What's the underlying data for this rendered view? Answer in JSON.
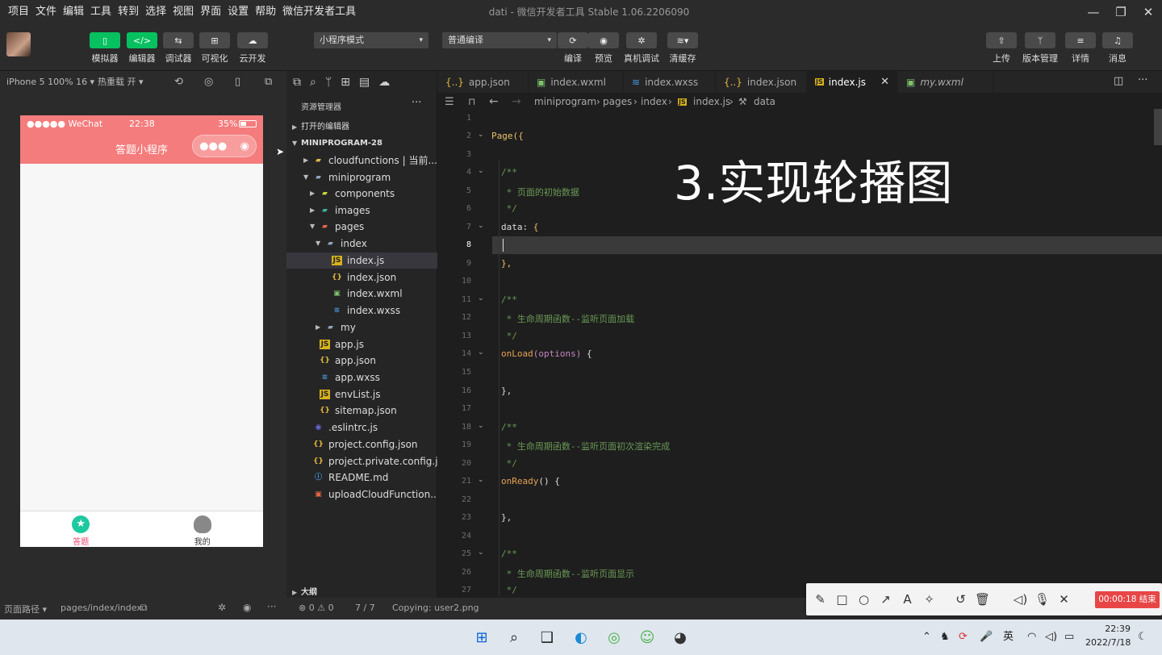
{
  "menu": [
    "项目",
    "文件",
    "编辑",
    "工具",
    "转到",
    "选择",
    "视图",
    "界面",
    "设置",
    "帮助",
    "微信开发者工具"
  ],
  "window_title": "dati - 微信开发者工具 Stable 1.06.2206090",
  "toolbar": {
    "simulator": "模拟器",
    "editor": "编辑器",
    "debugger": "调试器",
    "visual": "可视化",
    "cloud": "云开发",
    "mode_select": "小程序模式",
    "compile_select": "普通编译",
    "compile": "编译",
    "preview": "预览",
    "remote_debug": "真机调试",
    "clear_cache": "清缓存",
    "upload": "上传",
    "version": "版本管理",
    "details": "详情",
    "messages": "消息"
  },
  "devbar": {
    "device": "iPhone 5 100% 16 ▾",
    "hotreload": "热重载 开 ▾"
  },
  "phone": {
    "carrier": "●●●●● WeChat",
    "time": "22:38",
    "battery": "35%",
    "title": "答题小程序",
    "tab1": "答题",
    "tab2": "我的"
  },
  "explorer": {
    "title": "资源管理器",
    "open_editors": "打开的编辑器",
    "project": "MINIPROGRAM-28",
    "outline": "大纲",
    "items": [
      "cloudfunctions | 当前...",
      "miniprogram",
      "components",
      "images",
      "pages",
      "index",
      "index.js",
      "index.json",
      "index.wxml",
      "index.wxss",
      "my",
      "app.js",
      "app.json",
      "app.wxss",
      "envList.js",
      "sitemap.json",
      ".eslintrc.js",
      "project.config.json",
      "project.private.config.js...",
      "README.md",
      "uploadCloudFunction...."
    ]
  },
  "tabs": [
    "app.json",
    "index.wxml",
    "index.wxss",
    "index.json",
    "index.js",
    "my.wxml"
  ],
  "breadcrumb": {
    "p1": "miniprogram",
    "p2": "pages",
    "p3": "index",
    "p4": "index.js",
    "p5": "data"
  },
  "code": {
    "l3": "Page({",
    "l5": "/**",
    "l6": " * 页面的初始数据",
    "l7": " */",
    "l8a": "data: ",
    "l8b": "{",
    "l10": "},",
    "l12": "/**",
    "l13": " * 生命周期函数--监听页面加载",
    "l14": " */",
    "l15a": "onLoad",
    "l15b": "(options)",
    "l15c": " {",
    "l17": "},",
    "l19": "/**",
    "l20": " * 生命周期函数--监听页面初次渲染完成",
    "l21": " */",
    "l22a": "onReady",
    "l22b": "() {",
    "l24": "},",
    "l26": "/**",
    "l27": " * 生命周期函数--监听页面显示",
    "l28": " */"
  },
  "line_numbers": [
    "1",
    "2",
    "3",
    "4",
    "5",
    "6",
    "7",
    "8",
    "9",
    "10",
    "11",
    "12",
    "13",
    "14",
    "15",
    "16",
    "17",
    "18",
    "19",
    "20",
    "21",
    "22",
    "23",
    "24",
    "25",
    "26",
    "27"
  ],
  "overlay_title": "3.实现轮播图",
  "status": {
    "path_label": "页面路径 ▾",
    "path": "pages/index/index",
    "errors": "⊗ 0 ⚠ 0",
    "pos": "7 / 7",
    "copying": "Copying: user2.png"
  },
  "recorder": "00:00:18 结束",
  "tray": {
    "lang": "英",
    "time": "22:39",
    "date": "2022/7/18"
  }
}
